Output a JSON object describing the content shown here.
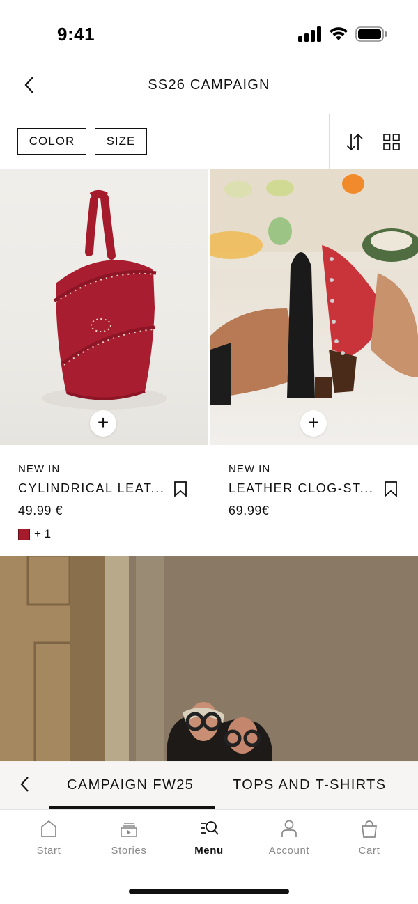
{
  "status_bar": {
    "time": "9:41"
  },
  "header": {
    "title": "SS26 CAMPAIGN"
  },
  "filters": {
    "color_label": "COLOR",
    "size_label": "SIZE"
  },
  "products": [
    {
      "badge": "NEW IN",
      "name": "CYLINDRICAL LEAT...",
      "price": "49.99 €",
      "swatch_color": "#a51b2c",
      "more_colors": "+ 1"
    },
    {
      "badge": "NEW IN",
      "name": "LEATHER CLOG-ST...",
      "price": "69.99€"
    }
  ],
  "category_tabs": {
    "items": [
      "CAMPAIGN FW25",
      "TOPS AND T-SHIRTS"
    ],
    "active": "CAMPAIGN FW25"
  },
  "tabbar": {
    "items": [
      {
        "label": "Start",
        "icon": "home-icon"
      },
      {
        "label": "Stories",
        "icon": "stories-icon"
      },
      {
        "label": "Menu",
        "icon": "menu-search-icon"
      },
      {
        "label": "Account",
        "icon": "account-icon"
      },
      {
        "label": "Cart",
        "icon": "cart-icon"
      }
    ],
    "active": "Menu"
  },
  "colors": {
    "accent": "#111111",
    "swatch": "#a51b2c",
    "inactive_label": "#8a8a8a"
  }
}
